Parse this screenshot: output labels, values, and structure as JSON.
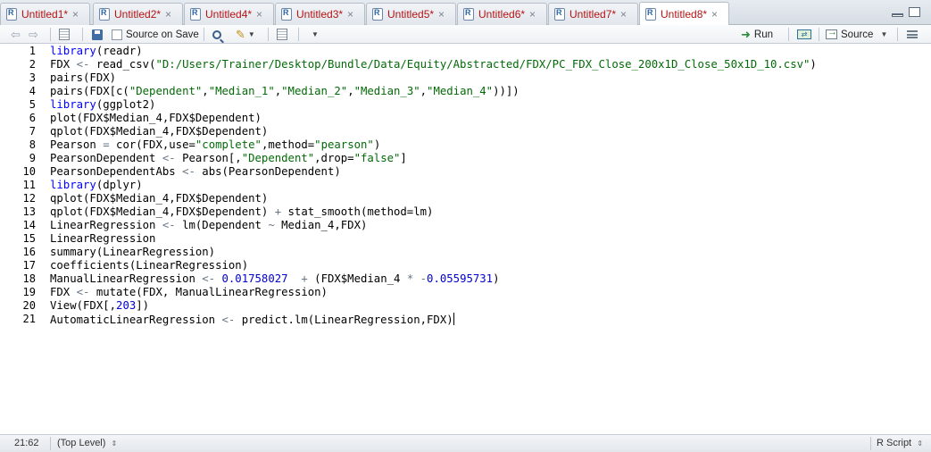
{
  "tabs": [
    {
      "label": "Untitled1*"
    },
    {
      "label": "Untitled2*"
    },
    {
      "label": "Untitled4*"
    },
    {
      "label": "Untitled3*"
    },
    {
      "label": "Untitled5*"
    },
    {
      "label": "Untitled6*"
    },
    {
      "label": "Untitled7*"
    },
    {
      "label": "Untitled8*"
    }
  ],
  "active_tab": 7,
  "toolbar": {
    "source_on_save": "Source on Save",
    "run": "Run",
    "source": "Source"
  },
  "code": [
    [
      [
        "fn",
        "library"
      ],
      [
        "p",
        "(readr)"
      ]
    ],
    [
      [
        "p",
        "FDX "
      ],
      [
        "op",
        "<-"
      ],
      [
        "p",
        " read_csv("
      ],
      [
        "str",
        "\"D:/Users/Trainer/Desktop/Bundle/Data/Equity/Abstracted/FDX/PC_FDX_Close_200x1D_Close_50x1D_10.csv\""
      ],
      [
        "p",
        ")"
      ]
    ],
    [
      [
        "p",
        "pairs(FDX)"
      ]
    ],
    [
      [
        "p",
        "pairs(FDX[c("
      ],
      [
        "str",
        "\"Dependent\""
      ],
      [
        "p",
        ","
      ],
      [
        "str",
        "\"Median_1\""
      ],
      [
        "p",
        ","
      ],
      [
        "str",
        "\"Median_2\""
      ],
      [
        "p",
        ","
      ],
      [
        "str",
        "\"Median_3\""
      ],
      [
        "p",
        ","
      ],
      [
        "str",
        "\"Median_4\""
      ],
      [
        "p",
        "))])"
      ]
    ],
    [
      [
        "fn",
        "library"
      ],
      [
        "p",
        "(ggplot2)"
      ]
    ],
    [
      [
        "p",
        "plot(FDX$Median_4,FDX$Dependent)"
      ]
    ],
    [
      [
        "p",
        "qplot(FDX$Median_4,FDX$Dependent)"
      ]
    ],
    [
      [
        "p",
        "Pearson "
      ],
      [
        "op",
        "="
      ],
      [
        "p",
        " cor(FDX,use="
      ],
      [
        "str",
        "\"complete\""
      ],
      [
        "p",
        ",method="
      ],
      [
        "str",
        "\"pearson\""
      ],
      [
        "p",
        ")"
      ]
    ],
    [
      [
        "p",
        "PearsonDependent "
      ],
      [
        "op",
        "<-"
      ],
      [
        "p",
        " Pearson[,"
      ],
      [
        "str",
        "\"Dependent\""
      ],
      [
        "p",
        ",drop="
      ],
      [
        "str",
        "\"false\""
      ],
      [
        "p",
        "]"
      ]
    ],
    [
      [
        "p",
        "PearsonDependentAbs "
      ],
      [
        "op",
        "<-"
      ],
      [
        "p",
        " abs(PearsonDependent)"
      ]
    ],
    [
      [
        "fn",
        "library"
      ],
      [
        "p",
        "(dplyr)"
      ]
    ],
    [
      [
        "p",
        "qplot(FDX$Median_4,FDX$Dependent)"
      ]
    ],
    [
      [
        "p",
        "qplot(FDX$Median_4,FDX$Dependent) "
      ],
      [
        "op",
        "+"
      ],
      [
        "p",
        " stat_smooth(method=lm)"
      ]
    ],
    [
      [
        "p",
        "LinearRegression "
      ],
      [
        "op",
        "<-"
      ],
      [
        "p",
        " lm(Dependent "
      ],
      [
        "op",
        "~"
      ],
      [
        "p",
        " Median_4,FDX)"
      ]
    ],
    [
      [
        "p",
        "LinearRegression"
      ]
    ],
    [
      [
        "p",
        "summary(LinearRegression)"
      ]
    ],
    [
      [
        "p",
        "coefficients(LinearRegression)"
      ]
    ],
    [
      [
        "p",
        "ManualLinearRegression "
      ],
      [
        "op",
        "<-"
      ],
      [
        "p",
        " "
      ],
      [
        "num",
        "0.01758027"
      ],
      [
        "p",
        "  "
      ],
      [
        "op",
        "+"
      ],
      [
        "p",
        " (FDX$Median_4 "
      ],
      [
        "op",
        "*"
      ],
      [
        "p",
        " "
      ],
      [
        "op",
        "-"
      ],
      [
        "num",
        "0.05595731"
      ],
      [
        "p",
        ")"
      ]
    ],
    [
      [
        "p",
        "FDX "
      ],
      [
        "op",
        "<-"
      ],
      [
        "p",
        " mutate(FDX, ManualLinearRegression)"
      ]
    ],
    [
      [
        "p",
        "View(FDX[,"
      ],
      [
        "num",
        "203"
      ],
      [
        "p",
        "])"
      ]
    ],
    [
      [
        "p",
        "AutomaticLinearRegression "
      ],
      [
        "op",
        "<-"
      ],
      [
        "p",
        " predict.lm(LinearRegression,FDX)"
      ]
    ]
  ],
  "colors": {
    "plain": "#000000",
    "fn": "#0000ff",
    "str": "#036a07",
    "op": "#687687",
    "num": "#0000cd"
  },
  "status": {
    "position": "21:62",
    "scope": "(Top Level)",
    "filetype": "R Script"
  }
}
